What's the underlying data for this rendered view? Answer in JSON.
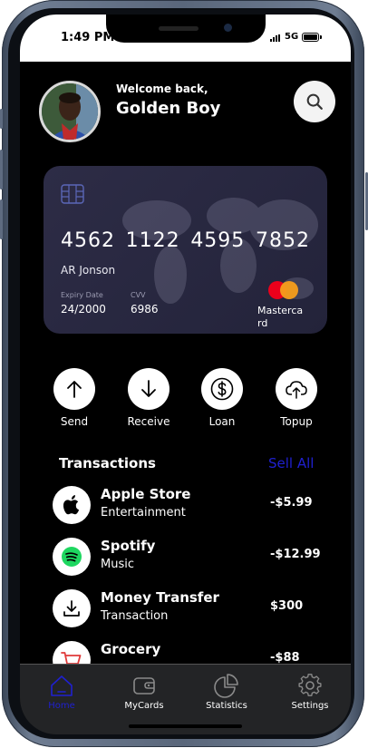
{
  "status_bar": {
    "time": "1:49 PM",
    "network": "5G"
  },
  "header": {
    "welcome": "Welcome back,",
    "username": "Golden Boy"
  },
  "card": {
    "number_groups": [
      "4562",
      "1122",
      "4595",
      "7852"
    ],
    "holder": "AR Jonson",
    "expiry_label": "Expiry Date",
    "expiry_value": "24/2000",
    "cvv_label": "CVV",
    "cvv_value": "6986",
    "brand": "Mastercard",
    "colors": {
      "card_bg": "#2d2c46",
      "mc_red": "#eb001b",
      "mc_yellow": "#f79e1b"
    }
  },
  "actions": [
    {
      "label": "Send",
      "icon": "arrow-up-icon"
    },
    {
      "label": "Receive",
      "icon": "arrow-down-icon"
    },
    {
      "label": "Loan",
      "icon": "dollar-icon"
    },
    {
      "label": "Topup",
      "icon": "cloud-upload-icon"
    }
  ],
  "transactions": {
    "title": "Transactions",
    "see_all": "Sell All",
    "items": [
      {
        "name": "Apple Store",
        "category": "Entertainment",
        "amount": "-$5.99",
        "icon": "apple-icon"
      },
      {
        "name": "Spotify",
        "category": "Music",
        "amount": "-$12.99",
        "icon": "spotify-icon"
      },
      {
        "name": "Money Transfer",
        "category": "Transaction",
        "amount": "$300",
        "icon": "download-icon"
      },
      {
        "name": "Grocery",
        "category": "",
        "amount": "-$88",
        "icon": "cart-icon"
      }
    ]
  },
  "nav": {
    "items": [
      {
        "label": "Home",
        "icon": "home-icon",
        "active": true
      },
      {
        "label": "MyCards",
        "icon": "wallet-icon",
        "active": false
      },
      {
        "label": "Statistics",
        "icon": "pie-chart-icon",
        "active": false
      },
      {
        "label": "Settings",
        "icon": "gear-icon",
        "active": false
      }
    ],
    "active_color": "#1f20cf"
  }
}
